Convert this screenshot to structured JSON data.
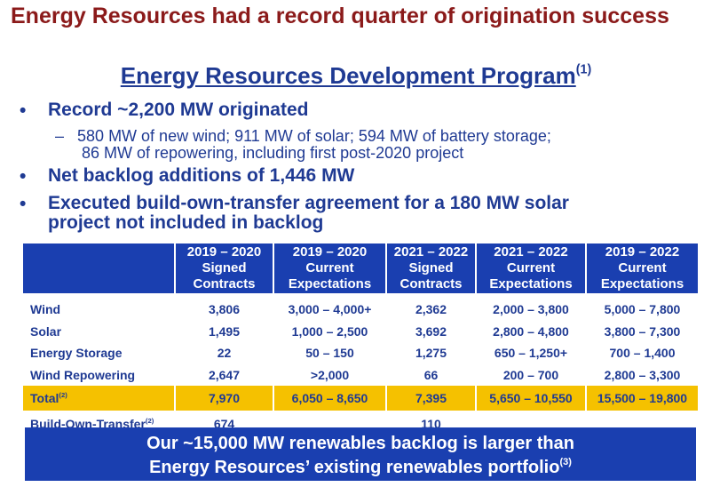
{
  "title": "Energy Resources had a record quarter of origination success",
  "subtitle": {
    "text": "Energy Resources Development Program",
    "note": "(1)"
  },
  "bullets": [
    {
      "text": "Record ~2,200 MW originated",
      "sub": [
        "580 MW of new wind; 911 MW of solar; 594 MW of battery storage;",
        "86 MW of repowering, including first post-2020 project"
      ]
    },
    {
      "text": "Net backlog additions of 1,446 MW"
    },
    {
      "text": "Executed build-own-transfer agreement for a 180 MW solar",
      "text2": "project not included in backlog"
    }
  ],
  "dash": "–",
  "table": {
    "headers": [
      [
        "2019 – 2020",
        "Signed",
        "Contracts"
      ],
      [
        "2019 – 2020",
        "Current",
        "Expectations"
      ],
      [
        "2021 – 2022",
        "Signed",
        "Contracts"
      ],
      [
        "2021 – 2022",
        "Current",
        "Expectations"
      ],
      [
        "2019 – 2022",
        "Current",
        "Expectations"
      ]
    ],
    "rows": [
      {
        "label": "Wind",
        "cells": [
          "3,806",
          "3,000 – 4,000+",
          "2,362",
          "2,000 – 3,800",
          "5,000 – 7,800"
        ]
      },
      {
        "label": "Solar",
        "cells": [
          "1,495",
          "1,000 – 2,500",
          "3,692",
          "2,800 – 4,800",
          "3,800 – 7,300"
        ]
      },
      {
        "label": "Energy Storage",
        "cells": [
          "22",
          "50 – 150",
          "1,275",
          "650 – 1,250+",
          "700 – 1,400"
        ]
      },
      {
        "label": "Wind Repowering",
        "cells": [
          "2,647",
          ">2,000",
          "66",
          "200 – 700",
          "2,800 – 3,300"
        ]
      }
    ],
    "total": {
      "label": "Total",
      "note": "(2)",
      "cells": [
        "7,970",
        "6,050 – 8,650",
        "7,395",
        "5,650 – 10,550",
        "15,500 – 19,800"
      ]
    },
    "bot": {
      "label": "Build-Own-Transfer",
      "note": "(2)",
      "cells": [
        "674",
        "",
        "110",
        "",
        ""
      ]
    }
  },
  "banner": {
    "line1": "Our ~15,000 MW renewables backlog is larger than",
    "line2": "Energy Resources’ existing renewables portfolio",
    "note": "(3)"
  }
}
